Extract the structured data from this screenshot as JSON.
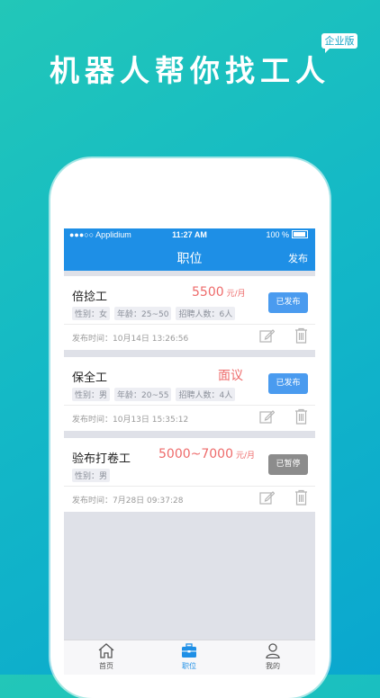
{
  "promo": {
    "headline": "机器人帮你找工人",
    "badge": "企业版"
  },
  "status_bar": {
    "carrier": "●●●○○ Applidium",
    "time": "11:27 AM",
    "battery": "100 %"
  },
  "nav": {
    "title": "职位",
    "action": "发布"
  },
  "jobs": [
    {
      "title": "倍捻工",
      "salary": "5500",
      "unit": "元/月",
      "tags": [
        "性别：女",
        "年龄：25~50",
        "招聘人数：6人"
      ],
      "status": "已发布",
      "publish_time": "发布时间：10月14日 13:26:56"
    },
    {
      "title": "保全工",
      "salary": "面议",
      "unit": "",
      "tags": [
        "性别：男",
        "年龄：20~55",
        "招聘人数：4人"
      ],
      "status": "已发布",
      "publish_time": "发布时间：10月13日 15:35:12"
    },
    {
      "title": "验布打卷工",
      "salary": "5000~7000",
      "unit": "元/月",
      "tags": [
        "性别：男"
      ],
      "status": "已暂停",
      "publish_time": "发布时间：7月28日 09:37:28"
    }
  ],
  "tabs": [
    {
      "label": "首页",
      "icon": "home-icon"
    },
    {
      "label": "职位",
      "icon": "briefcase-icon"
    },
    {
      "label": "我的",
      "icon": "person-icon"
    }
  ],
  "colors": {
    "accent": "#1e8fe6",
    "salary": "#ee6b6b",
    "published": "#4a9bef",
    "paused": "#8c8c8c"
  }
}
